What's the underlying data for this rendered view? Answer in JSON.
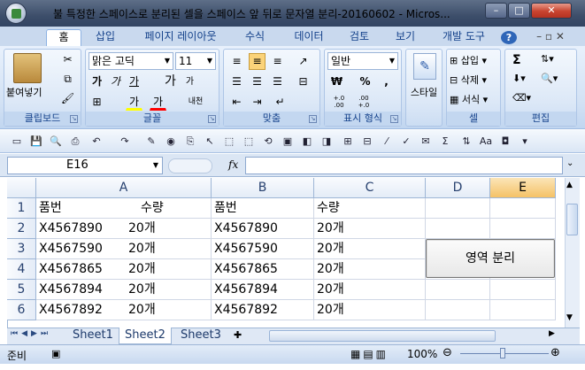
{
  "window": {
    "title": "불 특정한 스페이스로 분리된 셀을 스페이스 앞 뒤로 문자열 분리-20160602 - Micros..."
  },
  "ribbon_tabs": [
    "홈",
    "삽입",
    "페이지 레이아웃",
    "수식",
    "데이터",
    "검토",
    "보기",
    "개발 도구"
  ],
  "home": {
    "clipboard": {
      "paste_label": "붙여넣기",
      "group_label": "클립보드"
    },
    "font": {
      "font_name": "맑은 고딕",
      "font_size": "11",
      "group_label": "글꼴",
      "grow": "가",
      "shrink": "가",
      "bold": "가",
      "italic": "가",
      "underline": "가",
      "fill_glyph": "가",
      "font_color_glyph": "가",
      "phonetic": "내천"
    },
    "alignment": {
      "group_label": "맞춤"
    },
    "number": {
      "format": "일반",
      "currency": "₩",
      "percent": "%",
      "comma": ",",
      "inc_decimal": "+.0 .00",
      "dec_decimal": ".00 +.0",
      "group_label": "표시 형식"
    },
    "styles": {
      "label": "스타일"
    },
    "cells": {
      "insert": "삽입",
      "delete": "삭제",
      "format": "서식",
      "group_label": "셀"
    },
    "editing": {
      "group_label": "편집",
      "sum": "Σ"
    }
  },
  "formula_bar": {
    "name_box": "E16",
    "fx": "fx",
    "formula": ""
  },
  "columns": [
    "A",
    "B",
    "C",
    "D",
    "E"
  ],
  "rows": [
    {
      "n": "1",
      "a1": "품번",
      "a2": "수량",
      "b": "품번",
      "c": "수량"
    },
    {
      "n": "2",
      "a1": "X4567890",
      "a2": "20개",
      "b": "X4567890",
      "c": "20개"
    },
    {
      "n": "3",
      "a1": "X4567590",
      "a2": "20개",
      "b": "X4567590",
      "c": "20개"
    },
    {
      "n": "4",
      "a1": "X4567865",
      "a2": "20개",
      "b": "X4567865",
      "c": "20개"
    },
    {
      "n": "5",
      "a1": "X4567894",
      "a2": "20개",
      "b": "X4567894",
      "c": "20개"
    },
    {
      "n": "6",
      "a1": "X4567892",
      "a2": "20개",
      "b": "X4567892",
      "c": "20개"
    }
  ],
  "split_button": {
    "label": "영역 분리"
  },
  "sheets": [
    "Sheet1",
    "Sheet2",
    "Sheet3"
  ],
  "status": {
    "ready": "준비",
    "zoom": "100%"
  },
  "colors": {
    "title": "#3d4e6a",
    "ribbon": "#d2e1f4",
    "accent": "#15428b",
    "selected_col": "#f9d99a"
  }
}
